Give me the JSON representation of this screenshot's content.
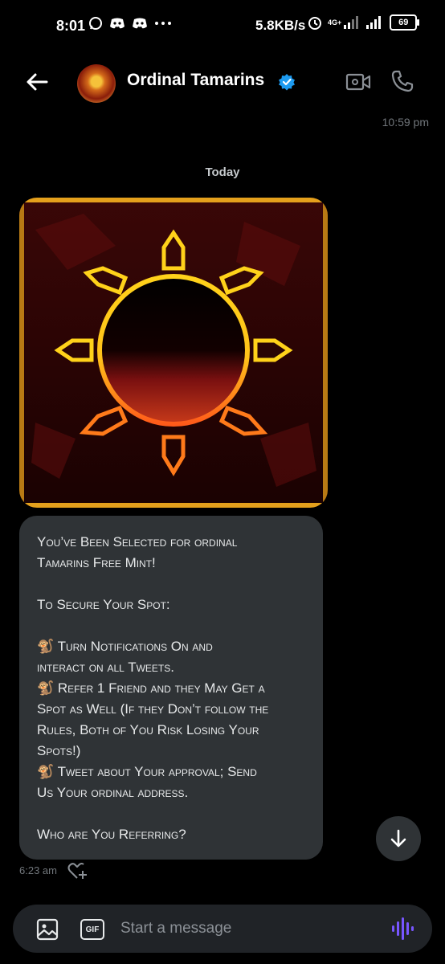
{
  "status_bar": {
    "time": "8:01",
    "net_speed": "5.8KB/s",
    "network_label": "4G+",
    "battery": "69"
  },
  "header": {
    "title": "Ordinal Tamarins"
  },
  "conversation": {
    "top_timestamp": "10:59 pm",
    "date_divider": "Today",
    "message": {
      "lines": [
        "You’ve Been Selected for ordinal",
        "Tamarins Free Mint!",
        "",
        "To Secure Your Spot:",
        "",
        "🐒 Turn Notifications On and",
        "interact on all Tweets.",
        "🐒 Refer 1 Friend and they May Get a",
        "Spot as Well (If they Don’t follow the",
        "Rules, Both of You Risk Losing Your",
        "Spots!)",
        "🐒 Tweet about Your approval; Send",
        "Us Your ordinal address.",
        "",
        "Who are You Referring?"
      ],
      "timestamp": "6:23 am"
    }
  },
  "composer": {
    "placeholder": "Start a message",
    "gif_label": "GIF"
  },
  "colors": {
    "accent_verified": "#1d9bf0",
    "voice_accent": "#7856ff",
    "bubble": "#2f3336"
  }
}
